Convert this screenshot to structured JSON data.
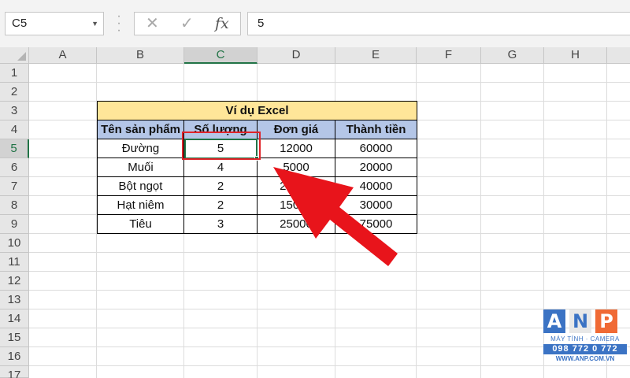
{
  "formula_bar": {
    "name_box": "C5",
    "cancel_icon": "✕",
    "enter_icon": "✓",
    "fx_label": "fx",
    "value": "5"
  },
  "columns": [
    "A",
    "B",
    "C",
    "D",
    "E",
    "F",
    "G",
    "H"
  ],
  "rows": [
    "1",
    "2",
    "3",
    "4",
    "5",
    "6",
    "7",
    "8",
    "9",
    "10",
    "11",
    "12",
    "13",
    "14",
    "15",
    "16",
    "17"
  ],
  "selected_cell": "C5",
  "table": {
    "title": "Ví dụ Excel",
    "headers": [
      "Tên sản phẩm",
      "Số lượng",
      "Đơn giá",
      "Thành tiền"
    ],
    "rows": [
      [
        "Đường",
        "5",
        "12000",
        "60000"
      ],
      [
        "Muối",
        "4",
        "5000",
        "20000"
      ],
      [
        "Bột ngọt",
        "2",
        "20000",
        "40000"
      ],
      [
        "Hạt niêm",
        "2",
        "15000",
        "30000"
      ],
      [
        "Tiêu",
        "3",
        "25000",
        "75000"
      ]
    ]
  },
  "annotation": {
    "highlight_color": "#e0242a",
    "arrow_color": "#e8141b"
  },
  "logo": {
    "letters": [
      "A",
      "N",
      "P"
    ],
    "subtitle": "MÁY TÍNH · CAMERA",
    "phone": "098 772 0 772",
    "website": "WWW.ANP.COM.VN"
  },
  "colors": {
    "title_fill": "#ffe699",
    "header_fill": "#b4c6e7",
    "selection_green": "#217346"
  }
}
